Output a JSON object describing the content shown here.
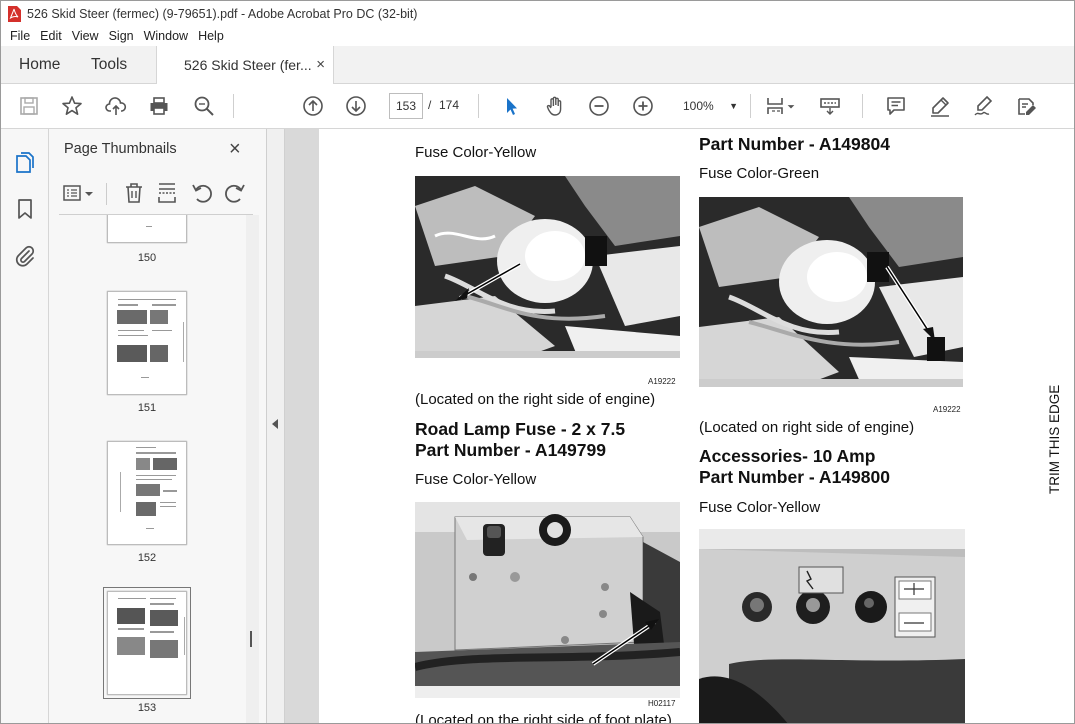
{
  "window": {
    "title": "526 Skid Steer (fermec) (9-79651).pdf - Adobe Acrobat Pro DC (32-bit)"
  },
  "menu": [
    "File",
    "Edit",
    "View",
    "Sign",
    "Window",
    "Help"
  ],
  "tabs": {
    "home": "Home",
    "tools": "Tools",
    "document": "526 Skid Steer (fer...",
    "close": "×"
  },
  "toolbar": {
    "current_page": "153",
    "page_separator": "/",
    "total_pages": "174",
    "zoom": "100%",
    "icons": [
      "save-icon",
      "star-icon",
      "upload-icon",
      "print-icon",
      "find-icon",
      "prev-page-icon",
      "next-page-icon",
      "select-cursor-icon",
      "hand-icon",
      "zoom-out-icon",
      "zoom-in-icon",
      "page-fit-icon",
      "keyboard-icon",
      "comment-icon",
      "highlight-pen-icon",
      "sign-icon",
      "edit-pdf-icon"
    ]
  },
  "thumbnails": {
    "title": "Page Thumbnails",
    "close": "×",
    "pages": [
      "150",
      "151",
      "152",
      "153"
    ],
    "selected": "153"
  },
  "document": {
    "left_column": {
      "fuse_color_top": "Fuse Color-Yellow",
      "photo1_code": "A19222",
      "photo1_caption": "(Located on the right side of engine)",
      "heading_line1": "Road Lamp Fuse - 2 x 7.5",
      "heading_line2": "Part Number - A149799",
      "fuse_color": "Fuse Color-Yellow",
      "photo2_code": "H02117",
      "photo2_caption": "(Located on the right side of foot plate)"
    },
    "right_column": {
      "heading_partial": "Part Number - A149804",
      "fuse_color_top": "Fuse Color-Green",
      "photo1_code": "A19222",
      "photo1_caption": "(Located on right side of engine)",
      "heading_line1": "Accessories- 10 Amp",
      "heading_line2": "Part Number - A149800",
      "fuse_color": "Fuse Color-Yellow"
    },
    "trim_label": "TRIM THIS EDGE"
  }
}
